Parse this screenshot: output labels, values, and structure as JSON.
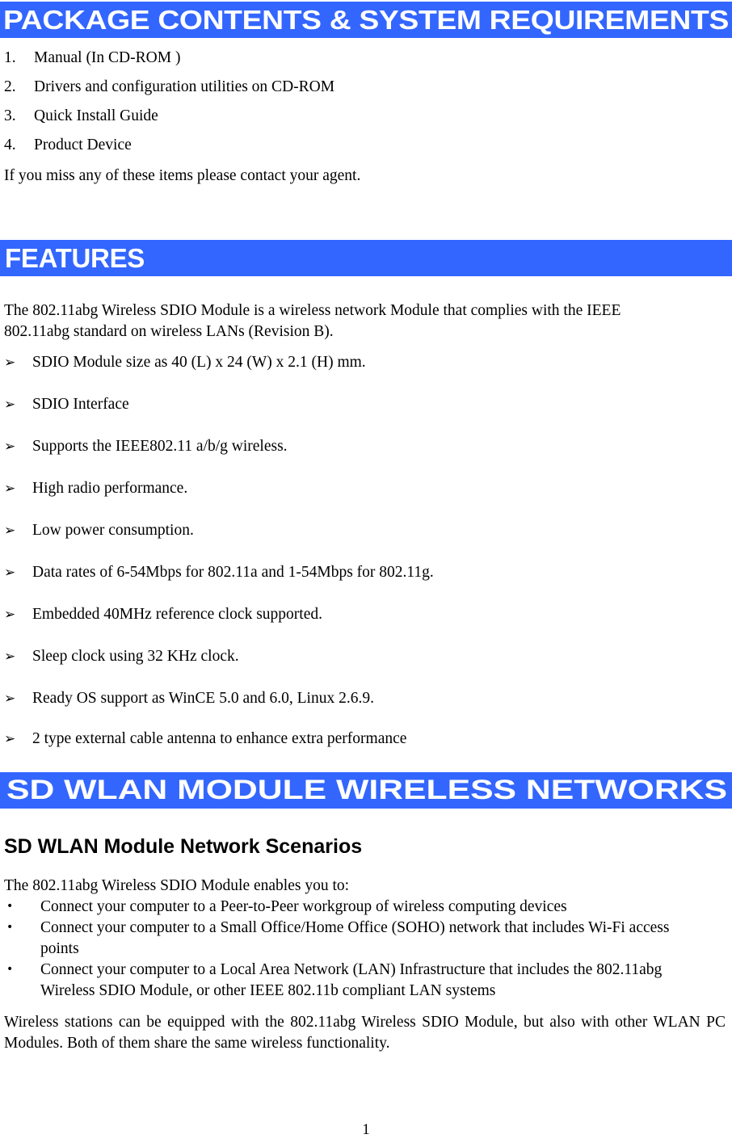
{
  "document": {
    "page_number": "1",
    "accent_color": "#3366FF",
    "text_color": "#000000",
    "background_color": "#FFFFFF"
  },
  "section_package": {
    "banner_title": "PACKAGE CONTENTS & SYSTEM REQUIREMENTS",
    "items": [
      {
        "number": "1.",
        "text": "Manual (In CD-ROM )"
      },
      {
        "number": "2.",
        "text": "Drivers and configuration utilities on CD-ROM"
      },
      {
        "number": "3.",
        "text": "Quick Install Guide"
      },
      {
        "number": "4.",
        "text": "Product Device"
      }
    ],
    "closing_note": "If you miss any of these items please contact your agent."
  },
  "section_features": {
    "banner_title": "FEATURES",
    "intro": "The 802.11abg Wireless SDIO Module is a wireless network Module that complies with the IEEE 802.11abg standard on wireless LANs (Revision B).",
    "bullet_glyph": "➢",
    "bullets": [
      "SDIO Module size as 40 (L) x 24 (W) x 2.1 (H) mm.",
      "SDIO Interface",
      "Supports the IEEE802.11 a/b/g wireless.",
      "High radio performance.",
      "Low power consumption.",
      "Data rates of 6-54Mbps for 802.11a and 1-54Mbps for 802.11g.",
      "Embedded 40MHz reference clock supported.",
      "Sleep clock using 32 KHz clock.",
      "Ready OS support as WinCE 5.0 and 6.0, Linux 2.6.9.",
      "2 type external cable antenna to enhance extra performance"
    ]
  },
  "section_networks": {
    "banner_title": "SD WLAN MODULE WIRELESS NETWORKS",
    "subheading": "SD WLAN Module Network Scenarios",
    "intro": "The 802.11abg Wireless SDIO Module enables you to:",
    "bullet_glyph": "•",
    "bullets": [
      {
        "main": "Connect your computer to a Peer-to-Peer workgroup of wireless computing devices",
        "lastline": ""
      },
      {
        "main": "Connect your computer to a Small Office/Home Office (SOHO) network that includes Wi-Fi access",
        "lastline": "points"
      },
      {
        "main": "Connect your computer to a Local Area Network (LAN) Infrastructure that includes the 802.11abg",
        "lastline": "Wireless SDIO Module, or other IEEE 802.11b compliant LAN systems"
      }
    ],
    "closing_paragraph": "Wireless stations can be equipped with the 802.11abg Wireless SDIO Module, but also with other WLAN PC Modules. Both of them share the same wireless functionality."
  }
}
